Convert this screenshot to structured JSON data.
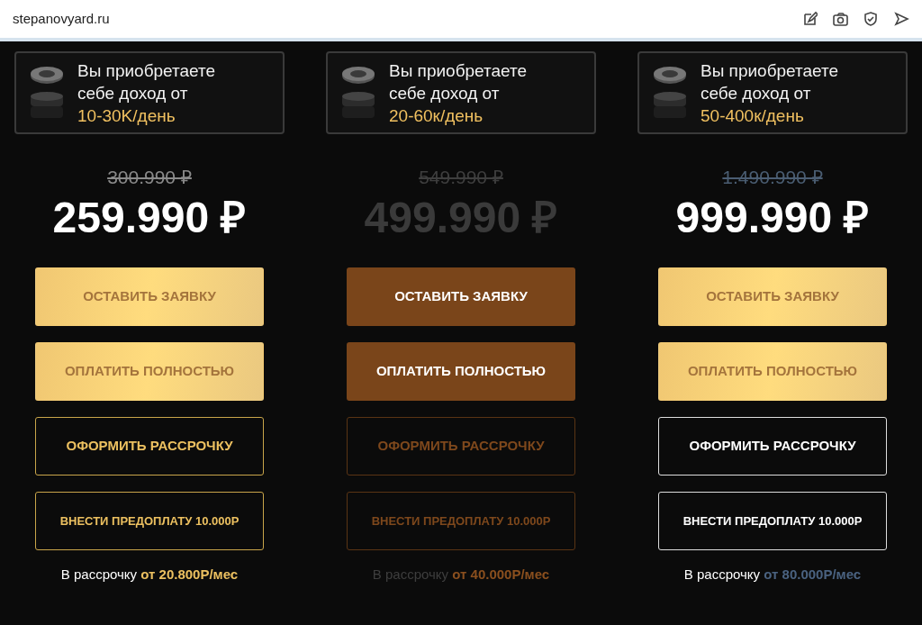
{
  "browser": {
    "url": "stepanovyard.ru"
  },
  "plans": [
    {
      "kind": "gold",
      "income_text": "Вы приобретаете себе доход от",
      "income_range": "10-30K/день",
      "old_price": "300.990 ₽",
      "price": "259.990 ₽",
      "buttons": [
        {
          "label": "ОСТАВИТЬ ЗАЯВКУ",
          "kind": "filled"
        },
        {
          "label": "ОПЛАТИТЬ ПОЛНОСТЬЮ",
          "kind": "filled"
        },
        {
          "label": "ОФОРМИТЬ РАССРОЧКУ",
          "kind": "outline"
        },
        {
          "label": "ВНЕСТИ ПРЕДОПЛАТУ 10.000Р",
          "kind": "outline"
        }
      ],
      "installment_prefix": "В рассрочку",
      "installment_amount": "от 20.800Р/мес"
    },
    {
      "kind": "bronze",
      "income_text": "Вы приобретаете себе доход от",
      "income_range": "20-60к/день",
      "old_price": "549.990 ₽",
      "price": "499.990 ₽",
      "buttons": [
        {
          "label": "ОСТАВИТЬ ЗАЯВКУ",
          "kind": "filled"
        },
        {
          "label": "ОПЛАТИТЬ ПОЛНОСТЬЮ",
          "kind": "filled"
        },
        {
          "label": "ОФОРМИТЬ РАССРОЧКУ",
          "kind": "outline"
        },
        {
          "label": "ВНЕСТИ ПРЕДОПЛАТУ 10.000Р",
          "kind": "outline"
        }
      ],
      "installment_prefix": "В рассрочку",
      "installment_amount": "от 40.000Р/мес"
    },
    {
      "kind": "white",
      "income_text": "Вы приобретаете себе доход от",
      "income_range": "50-400к/день",
      "old_price": "1.490.990 ₽",
      "price": "999.990 ₽",
      "buttons": [
        {
          "label": "ОСТАВИТЬ ЗАЯВКУ",
          "kind": "filled"
        },
        {
          "label": "ОПЛАТИТЬ ПОЛНОСТЬЮ",
          "kind": "filled"
        },
        {
          "label": "ОФОРМИТЬ РАССРОЧКУ",
          "kind": "outline"
        },
        {
          "label": "ВНЕСТИ ПРЕДОПЛАТУ 10.000Р",
          "kind": "outline"
        }
      ],
      "installment_prefix": "В рассрочку",
      "installment_amount": "от 80.000Р/мес"
    }
  ]
}
